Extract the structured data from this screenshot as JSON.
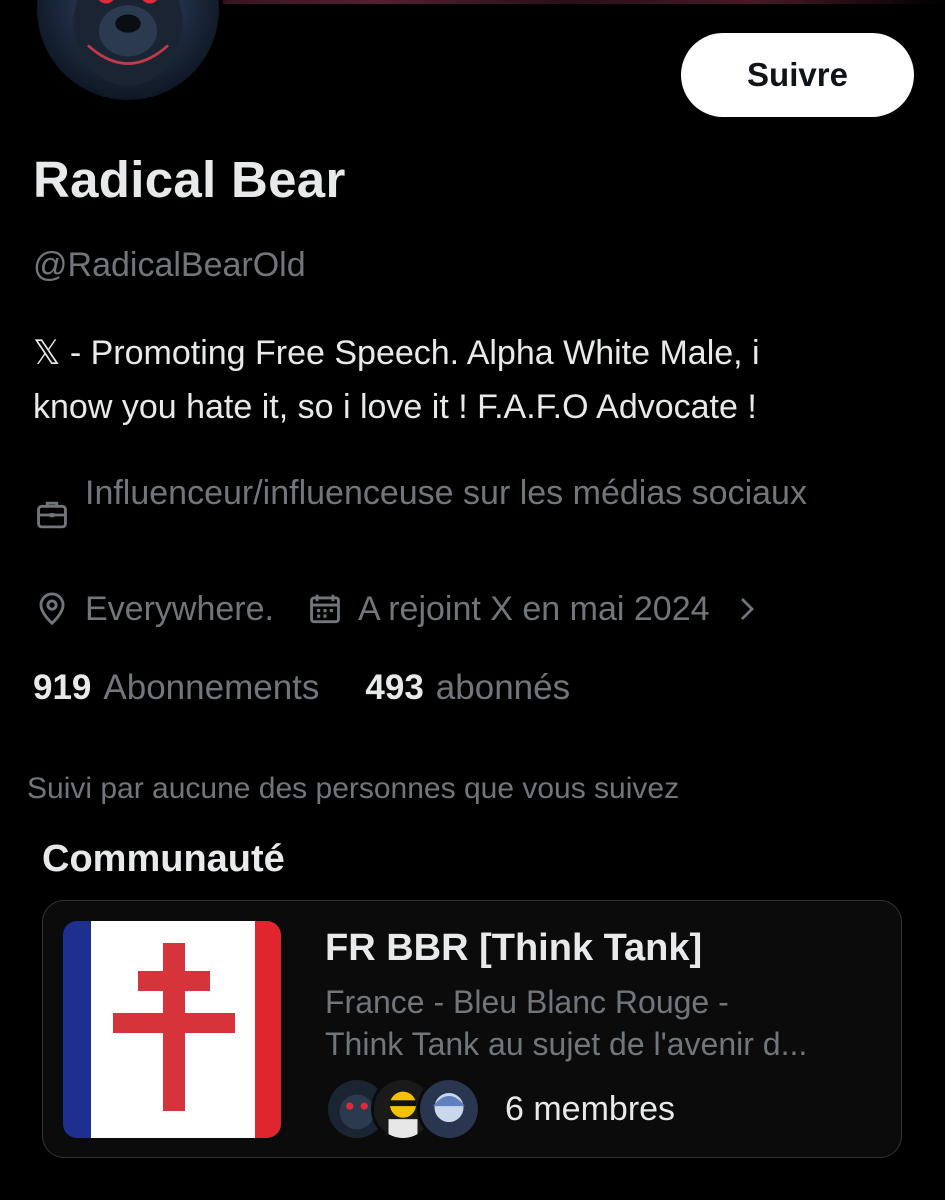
{
  "profile": {
    "display_name": "Radical Bear",
    "handle": "@RadicalBearOld",
    "follow_label": "Suivre",
    "bio_line1": "𝕏 - Promoting Free Speech. Alpha White Male, i",
    "bio_line2": "know you hate it, so i love it ! F.A.F.O Advocate !",
    "category": "Influenceur/influenceuse sur les médias sociaux",
    "location": "Everywhere.",
    "joined": "A rejoint X en mai 2024",
    "following_count": "919",
    "following_label": "Abonnements",
    "followers_count": "493",
    "followers_label": "abonnés",
    "followed_by": "Suivi par aucune des personnes que vous suivez"
  },
  "community": {
    "section_title": "Communauté",
    "name": "FR BBR [Think Tank]",
    "desc_line1": "France - Bleu Blanc Rouge -",
    "desc_line2": "Think Tank au sujet de l'avenir d...",
    "members_label": "6 membres"
  },
  "icons": {
    "category": "briefcase-icon",
    "location": "location-pin-icon",
    "joined": "calendar-icon",
    "expand": "chevron-right-icon"
  },
  "colors": {
    "background": "#000000",
    "primary_text": "#e7e9ea",
    "secondary_text": "#71767b",
    "button_bg": "#ffffff",
    "flag_blue": "#1f2f8f",
    "flag_red": "#e1252e"
  }
}
